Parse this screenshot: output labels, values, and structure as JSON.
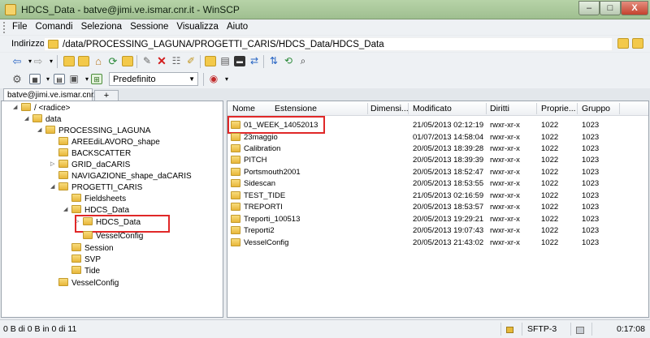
{
  "window": {
    "title": "HDCS_Data - batve@jimi.ve.ismar.cnr.it - WinSCP",
    "min": "–",
    "max": "□",
    "close": "X"
  },
  "menu": [
    "File",
    "Comandi",
    "Seleziona",
    "Sessione",
    "Visualizza",
    "Aiuto"
  ],
  "address": {
    "label": "Indirizzo",
    "path": "/data/PROCESSING_LAGUNA/PROGETTI_CARIS/HDCS_Data/HDCS_Data"
  },
  "toolbar": {
    "preset": "Predefinito"
  },
  "tabs": {
    "active": "batve@jimi.ve.ismar.cnr.it",
    "new": "+"
  },
  "tree": [
    {
      "label": "/ <radice>",
      "level": 0
    },
    {
      "label": "data",
      "level": 1
    },
    {
      "label": "PROCESSING_LAGUNA",
      "level": 2
    },
    {
      "label": "AREEdiLAVORO_shape",
      "level": 3
    },
    {
      "label": "BACKSCATTER",
      "level": 3
    },
    {
      "label": "GRID_daCARIS",
      "level": 3
    },
    {
      "label": "NAVIGAZIONE_shape_daCARIS",
      "level": 3
    },
    {
      "label": "PROGETTI_CARIS",
      "level": 3
    },
    {
      "label": "Fieldsheets",
      "level": 4
    },
    {
      "label": "HDCS_Data",
      "level": 4
    },
    {
      "label": "HDCS_Data",
      "level": 5
    },
    {
      "label": "VesselConfig",
      "level": 5
    },
    {
      "label": "Session",
      "level": 4
    },
    {
      "label": "SVP",
      "level": 4
    },
    {
      "label": "Tide",
      "level": 4
    },
    {
      "label": "VesselConfig",
      "level": 3
    }
  ],
  "list": {
    "columns": [
      "Nome",
      "Estensione",
      "Dimensi...",
      "Modificato",
      "Diritti",
      "Proprie...",
      "Gruppo"
    ],
    "rows": [
      {
        "name": "01_WEEK_14052013",
        "modified": "21/05/2013 02:12:19",
        "rights": "rwxr-xr-x",
        "owner": "1022",
        "group": "1023"
      },
      {
        "name": "23maggio",
        "modified": "01/07/2013 14:58:04",
        "rights": "rwxr-xr-x",
        "owner": "1022",
        "group": "1023"
      },
      {
        "name": "Calibration",
        "modified": "20/05/2013 18:39:28",
        "rights": "rwxr-xr-x",
        "owner": "1022",
        "group": "1023"
      },
      {
        "name": "PITCH",
        "modified": "20/05/2013 18:39:39",
        "rights": "rwxr-xr-x",
        "owner": "1022",
        "group": "1023"
      },
      {
        "name": "Portsmouth2001",
        "modified": "20/05/2013 18:52:47",
        "rights": "rwxr-xr-x",
        "owner": "1022",
        "group": "1023"
      },
      {
        "name": "Sidescan",
        "modified": "20/05/2013 18:53:55",
        "rights": "rwxr-xr-x",
        "owner": "1022",
        "group": "1023"
      },
      {
        "name": "TEST_TIDE",
        "modified": "21/05/2013 02:16:59",
        "rights": "rwxr-xr-x",
        "owner": "1022",
        "group": "1023"
      },
      {
        "name": "TREPORTI",
        "modified": "20/05/2013 18:53:57",
        "rights": "rwxr-xr-x",
        "owner": "1022",
        "group": "1023"
      },
      {
        "name": "Treporti_100513",
        "modified": "20/05/2013 19:29:21",
        "rights": "rwxr-xr-x",
        "owner": "1022",
        "group": "1023"
      },
      {
        "name": "Treporti2",
        "modified": "20/05/2013 19:07:43",
        "rights": "rwxr-xr-x",
        "owner": "1022",
        "group": "1023"
      },
      {
        "name": "VesselConfig",
        "modified": "20/05/2013 21:43:02",
        "rights": "rwxr-xr-x",
        "owner": "1022",
        "group": "1023"
      }
    ]
  },
  "status": {
    "text": "0 B di 0 B in 0 di 11",
    "protocol": "SFTP-3",
    "time": "0:17:08"
  },
  "colors": {
    "highlight": "#e02828",
    "folder": "#f3c94a",
    "titlebar": "#a9c79a"
  }
}
